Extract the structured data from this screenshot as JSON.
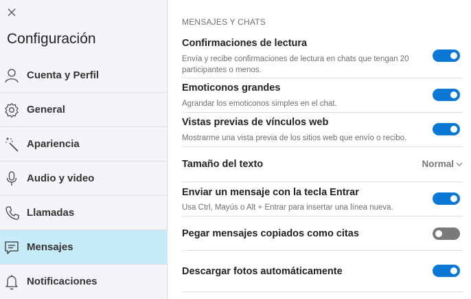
{
  "sidebar": {
    "title": "Configuración",
    "items": [
      {
        "label": "Cuenta y Perfil",
        "icon": "person-icon"
      },
      {
        "label": "General",
        "icon": "gear-icon"
      },
      {
        "label": "Apariencia",
        "icon": "magic-wand-icon"
      },
      {
        "label": "Audio y video",
        "icon": "microphone-icon"
      },
      {
        "label": "Llamadas",
        "icon": "phone-icon"
      },
      {
        "label": "Mensajes",
        "icon": "message-icon",
        "active": true
      },
      {
        "label": "Notificaciones",
        "icon": "bell-icon"
      }
    ]
  },
  "main": {
    "section_title": "MENSAJES Y CHATS",
    "settings": [
      {
        "title": "Confirmaciones de lectura",
        "desc": "Envía y recibe confirmaciones de lectura en chats que tengan 20 participantes o menos.",
        "enabled": true
      },
      {
        "title": "Emoticonos grandes",
        "desc": "Agrandar los emoticonos simples en el chat.",
        "enabled": true
      },
      {
        "title": "Vistas previas de vínculos web",
        "desc": "Mostrarme una vista previa de los sitios web que envío o recibo.",
        "enabled": true
      },
      {
        "title": "Tamaño del texto",
        "value": "Normal"
      },
      {
        "title": "Enviar un mensaje con la tecla Entrar",
        "desc": "Usa Ctrl, Mayús o Alt + Entrar para insertar una línea nueva.",
        "enabled": true
      },
      {
        "title": "Pegar mensajes copiados como citas",
        "enabled": false
      },
      {
        "title": "Descargar fotos automáticamente",
        "enabled": true
      }
    ]
  },
  "colors": {
    "accent": "#0a78d4",
    "active_nav": "#c8ebfa",
    "toggle_off": "#7a7a7a"
  }
}
